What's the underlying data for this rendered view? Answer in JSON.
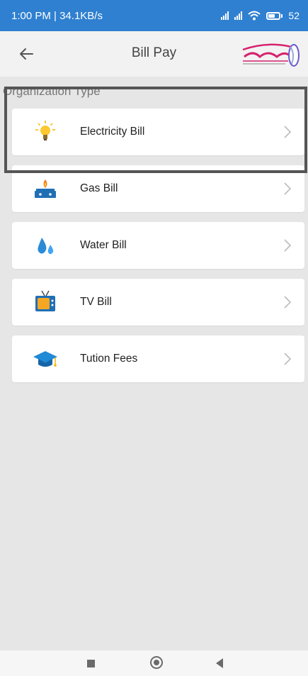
{
  "status_bar": {
    "time_speed": "1:00 PM | 34.1KB/s",
    "battery": "52"
  },
  "header": {
    "title": "Bill Pay"
  },
  "section_label": "Organization Type",
  "items": [
    {
      "label": "Electricity Bill",
      "icon": "bulb-icon"
    },
    {
      "label": "Gas Bill",
      "icon": "gas-stove-icon"
    },
    {
      "label": "Water Bill",
      "icon": "water-drops-icon"
    },
    {
      "label": "TV Bill",
      "icon": "tv-icon"
    },
    {
      "label": "Tution Fees",
      "icon": "graduation-cap-icon"
    }
  ],
  "colors": {
    "status_bar": "#2f80d0",
    "background": "#e6e6e6",
    "card": "#ffffff",
    "logo": "#d6226d"
  }
}
